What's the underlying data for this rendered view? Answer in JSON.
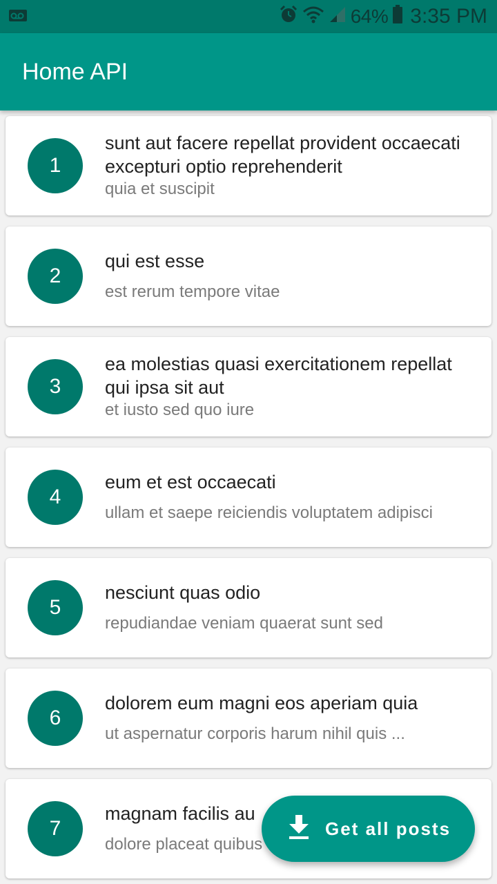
{
  "status_bar": {
    "battery_percent": "64%",
    "time": "3:35 PM",
    "icons": [
      "voicemail-icon",
      "alarm-icon",
      "wifi-icon",
      "signal-icon",
      "battery-icon"
    ]
  },
  "app_bar": {
    "title": "Home API"
  },
  "posts": [
    {
      "id": "1",
      "title": "sunt aut facere repellat provident occaecati excepturi optio reprehenderit",
      "subtitle": "quia et suscipit"
    },
    {
      "id": "2",
      "title": "qui est esse",
      "subtitle": "est rerum tempore vitae"
    },
    {
      "id": "3",
      "title": "ea molestias quasi exercitationem repellat qui ipsa sit aut",
      "subtitle": "et iusto sed quo iure"
    },
    {
      "id": "4",
      "title": "eum et est occaecati",
      "subtitle": "ullam et saepe reiciendis voluptatem adipisci"
    },
    {
      "id": "5",
      "title": "nesciunt quas odio",
      "subtitle": "repudiandae veniam quaerat sunt sed"
    },
    {
      "id": "6",
      "title": "dolorem eum magni eos aperiam quia",
      "subtitle": "ut aspernatur corporis harum nihil quis ..."
    },
    {
      "id": "7",
      "title": "magnam facilis au",
      "subtitle": "dolore placeat quibus"
    }
  ],
  "fab": {
    "label": "Get all posts",
    "icon": "download-icon"
  },
  "colors": {
    "primary": "#009688",
    "primary_dark": "#00796b",
    "avatar": "#00796b"
  }
}
